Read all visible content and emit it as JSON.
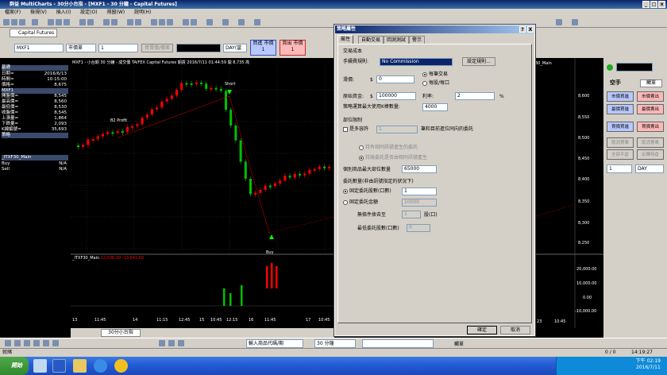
{
  "window": {
    "title": "群益 MultiCharts - 30分小台指 - [MXF1 - 30 分鐘 - Capital Futures]"
  },
  "menu": [
    "檔案(F)",
    "檢視(V)",
    "插入(I)",
    "設定(O)",
    "視窗(W)",
    "說明(H)"
  ],
  "workspace_tab": "Capital Futures",
  "order_bar": {
    "symbol": "MXF1",
    "price_type": "市價單",
    "qty": "1",
    "action": "買賣價/價差",
    "period": "DAY(當",
    "buy_label": "買進 市價",
    "buy_qty": "1",
    "sell_label": "賣出 市價",
    "sell_qty": "1"
  },
  "left_panel": {
    "header": "基礎",
    "rows": [
      {
        "label": "日期=",
        "value": "2016/6/13"
      },
      {
        "label": "時間=",
        "value": "10:15:00"
      },
      {
        "label": "價格=",
        "value": "8,675"
      },
      {
        "label": "MXF1",
        "value": ""
      },
      {
        "label": "開盤價=",
        "value": "8,545"
      },
      {
        "label": "最高價=",
        "value": "8,560"
      },
      {
        "label": "最低價=",
        "value": "8,530"
      },
      {
        "label": "收盤價=",
        "value": "8,545"
      },
      {
        "label": "上漲量=",
        "value": "1,864"
      },
      {
        "label": "下跌量=",
        "value": "2,093"
      },
      {
        "label": "K線編號=",
        "value": "35,693"
      },
      {
        "label": "策略",
        "value": ""
      }
    ],
    "strategy_name": "_ITXF30_Main",
    "buy_label": "Buy",
    "buy_value": "N/A",
    "sell_label": "Sell",
    "sell_value": "N/A"
  },
  "chart": {
    "header": "MXF1 - 小台期 30 分鐘 - 成交價 TAIFEX Capital Futures 期貨 2016/7/11 01:44:59 開 8,735 高",
    "right_header": "30_Main",
    "annotations": {
      "profit": "B2 Profit",
      "short": "Short",
      "buy": "Buy"
    },
    "price_ticks": [
      "8,600",
      "8,550",
      "8,500",
      "8,450",
      "8,400",
      "8,350",
      "8,300",
      "8,250"
    ],
    "sub_label": "_ITXF30_Main",
    "sub_val1": "12,036.00",
    "sub_val2": "-13,041.00",
    "sub_ticks": [
      "20,000.00",
      "10,000.00",
      "0.00",
      "-10,000.00"
    ],
    "time_ticks": [
      "13",
      "11:45",
      "14",
      "11:15",
      "12:45",
      "15",
      "10:45",
      "12:15",
      "16",
      "11:45",
      "17",
      "10:45"
    ],
    "time_ticks_right": [
      "23",
      "10:45"
    ],
    "tab_label": "30分小台指"
  },
  "dialog": {
    "title": "策略屬性",
    "help": "?",
    "close": "X",
    "tabs": [
      "屬性",
      "自動交易",
      "回測測試",
      "警示"
    ],
    "section_cost": "交易成本",
    "commission_label": "手續費規則:",
    "commission_value": "No Commission",
    "commission_btn": "設定規則...",
    "slippage_label": "滑價:",
    "currency": "$",
    "slippage_value": "0",
    "per_trade": "每筆交易",
    "per_contract": "每股/每口",
    "capital_label": "原始資金:",
    "capital_value": "100000",
    "interest_label": "利率:",
    "interest_value": "2",
    "percent": "%",
    "maxbars_label": "策略運算最大使用K棒數量:",
    "maxbars_value": "4000",
    "section_position": "部位限制",
    "pyramid_label": "是多容許",
    "pyramid_value": "1",
    "pyramid_desc": "筆和目前進位同向的委託",
    "opt1": "持有相同訊號進生的委託",
    "opt2": "持論委託是否由相同訊號產生",
    "maxshares_label": "個別商品最大部位數量",
    "maxshares_value": "65000",
    "section_size": "委託數量(非由訊號指定的狀況下)",
    "fixed_contracts": "固定委託股數(口數)",
    "fixed_contracts_value": "1",
    "fixed_amount": "固定委託金額",
    "fixed_amount_value": "10000",
    "round_label": "無條件捨去至",
    "round_value": "1",
    "round_unit": "股(口)",
    "min_label": "最低委託股數(口數)",
    "min_value": "0",
    "ok": "確定",
    "cancel": "取消"
  },
  "right_panel": {
    "title": "空手",
    "trade_label": "觸單",
    "buttons": [
      {
        "left": "市價買進",
        "right": "市價賣出"
      },
      {
        "left": "最價買進",
        "right": "最價賣出"
      },
      {
        "left": "買價買進",
        "right": "買價賣出"
      }
    ],
    "cancel_buy": "取消買單",
    "cancel_sell": "取消賣單",
    "flat": "全部平倉",
    "reverse": "反轉持倉",
    "qty": "1",
    "period": "DAY"
  },
  "bottom_toolbar": {
    "symbol_field": "輸入商品代碼/期",
    "interval": "30 分鐘",
    "mode": "觸單"
  },
  "status": {
    "left": "就緒",
    "right1": "0 / 0",
    "time": "14:19:27"
  },
  "taskbar": {
    "start": "開始",
    "clock": "下午 02:19",
    "date": "2016/7/11"
  },
  "colors": {
    "up": "#ff0000",
    "down": "#00c000",
    "dialog_bg": "#d4d0c8",
    "title": "#0a246a"
  }
}
